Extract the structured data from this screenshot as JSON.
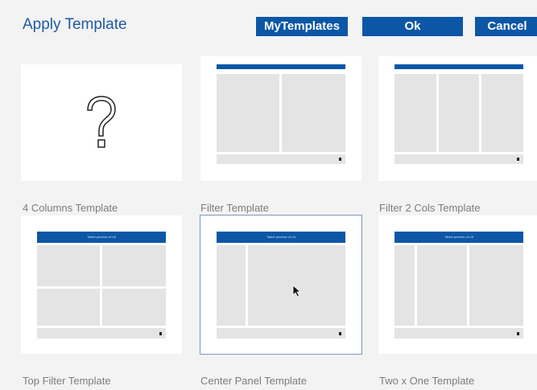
{
  "header": {
    "title": "Apply Template",
    "buttons": {
      "my_templates": "MyTemplates",
      "ok": "Ok",
      "cancel": "Cancel"
    }
  },
  "templates": [
    {
      "label": "4 Columns Template",
      "thumbnail": "question-icon",
      "header_text": ""
    },
    {
      "label": "Filter Template",
      "thumbnail": "two-panel",
      "header_text": ""
    },
    {
      "label": "Filter 2 Cols Template",
      "thumbnail": "three-columns",
      "header_text": ""
    },
    {
      "label": "Top Filter Template",
      "thumbnail": "four-panels",
      "header_text": "Tablet preview of LB"
    },
    {
      "label": "Center Panel Template",
      "thumbnail": "center-panel",
      "header_text": "Tablet preview of LB",
      "selected": true
    },
    {
      "label": "Two x One Template",
      "thumbnail": "two-by-one",
      "header_text": "Tablet preview of LB"
    }
  ],
  "colors": {
    "accent": "#0b57a6",
    "title": "#1d5aa6",
    "panel": "#e4e4e4",
    "background": "#f3f3f3",
    "label": "#7c7c7c"
  }
}
